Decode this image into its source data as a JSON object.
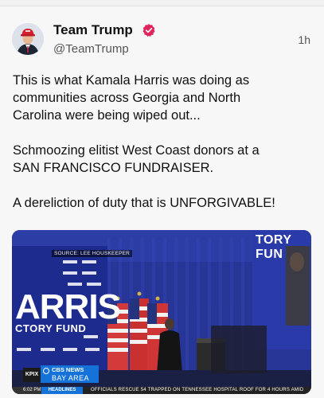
{
  "post": {
    "author_name": "Team Trump",
    "handle": "@TeamTrump",
    "timestamp": "1h",
    "paragraphs": [
      "This is what Kamala Harris was doing as\ncommunities across Georgia and North\nCarolina were being wiped out...",
      "Schmoozing elitist West Coast donors at a\nSAN FRANCISCO FUNDRAISER.",
      "A dereliction of duty that is UNFORGIVABLE!"
    ]
  },
  "video": {
    "source_label": "SOURCE: LEE HOUSKEEPER",
    "banner_big": "ARRIS",
    "banner_small": "CTORY FUND",
    "banner_right": "TORY FUN",
    "station_tag": "KPIX",
    "network_line1": "CBS NEWS",
    "network_line2": "BAY AREA",
    "clock": "6:02 PM",
    "ticker_label": "HEADLINES",
    "ticker_text": "OFFICIALS RESCUE 54 TRAPPED ON TENNESSEE HOSPITAL ROOF FOR 4 HOURS AMID"
  },
  "colors": {
    "verified_badge": "#e0245e",
    "cbs_blue": "#1572d8",
    "stage_blue": "#1f2a78"
  },
  "icons": {
    "verified": "verified-badge-icon",
    "cbs_eye": "cbs-eye-icon"
  }
}
